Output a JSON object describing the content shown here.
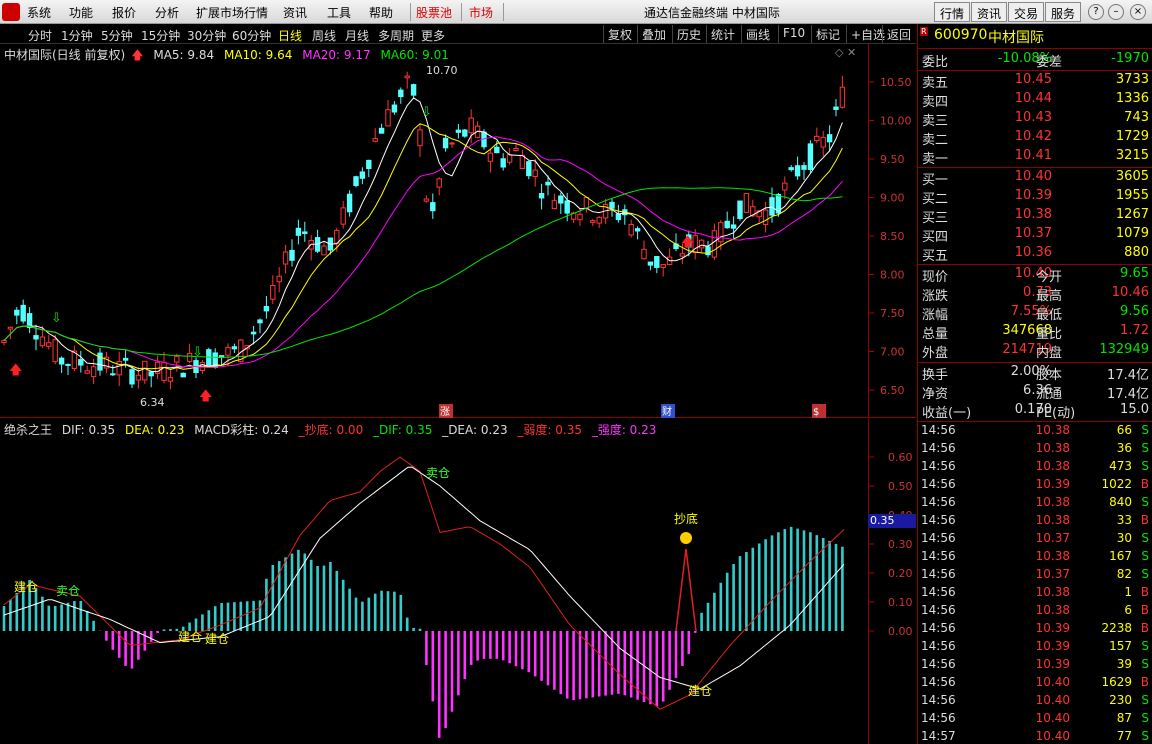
{
  "menu": {
    "items": [
      "系统",
      "功能",
      "报价",
      "分析",
      "扩展市场行情",
      "资讯",
      "工具",
      "帮助"
    ],
    "pool": "股票池",
    "market": "市场",
    "window_title": "通达信金融终端  中材国际",
    "right_buttons": [
      "行情",
      "资讯",
      "交易",
      "服务"
    ]
  },
  "toolbar": {
    "periods": [
      "分时",
      "1分钟",
      "5分钟",
      "15分钟",
      "30分钟",
      "60分钟",
      "日线",
      "周线",
      "月线",
      "多周期",
      "更多"
    ],
    "active": "日线",
    "right": [
      "复权",
      "叠加",
      "历史",
      "统计",
      "画线",
      "F10",
      "标记",
      "+自选",
      "返回"
    ]
  },
  "kinfo": {
    "title": "中材国际(日线 前复权)",
    "ma5": "MA5: 9.84",
    "ma10": "MA10: 9.64",
    "ma20": "MA20: 9.17",
    "ma60": "MA60: 9.01",
    "high_label": "10.70",
    "low_label": "6.34",
    "yticks": [
      "10.50",
      "10.00",
      "9.50",
      "9.00",
      "8.50",
      "8.00",
      "7.50",
      "7.00",
      "6.50"
    ],
    "markers": [
      "涨",
      "财",
      "$"
    ],
    "colors": {
      "ma5": "#ffffff",
      "ma10": "#ffff00",
      "ma20": "#ff00ff",
      "ma60": "#00e600",
      "up": "#ff3333",
      "down": "#54ffff"
    }
  },
  "macd": {
    "title": "绝杀之王",
    "dif": "DIF: 0.35",
    "dea": "DEA: 0.23",
    "bar": "MACD彩柱: 0.24",
    "x_chaodi": "_抄底: 0.00",
    "x_dif": "_DIF: 0.35",
    "x_dea": "_DEA: 0.23",
    "x_ruodu": "_弱度: 0.35",
    "x_qiangdu": "_强度: 0.23",
    "yticks": [
      "0.60",
      "0.50",
      "0.40",
      "0.30",
      "0.20",
      "0.10",
      "0.00"
    ],
    "cur_value": "0.35",
    "signals": {
      "build": "建仓",
      "sell": "卖仓",
      "bottom": "抄底"
    }
  },
  "quote": {
    "code": "600970",
    "name": "中材国际",
    "weibi_label": "委比",
    "weibi": "-10.08%",
    "weicha_label": "委差",
    "weicha": "-1970",
    "asks": [
      {
        "label": "卖五",
        "price": "10.45",
        "vol": "3733"
      },
      {
        "label": "卖四",
        "price": "10.44",
        "vol": "1336"
      },
      {
        "label": "卖三",
        "price": "10.43",
        "vol": "743"
      },
      {
        "label": "卖二",
        "price": "10.42",
        "vol": "1729"
      },
      {
        "label": "卖一",
        "price": "10.41",
        "vol": "3215"
      }
    ],
    "bids": [
      {
        "label": "买一",
        "price": "10.40",
        "vol": "3605"
      },
      {
        "label": "买二",
        "price": "10.39",
        "vol": "1955"
      },
      {
        "label": "买三",
        "price": "10.38",
        "vol": "1267"
      },
      {
        "label": "买四",
        "price": "10.37",
        "vol": "1079"
      },
      {
        "label": "买五",
        "price": "10.36",
        "vol": "880"
      }
    ],
    "stats": [
      {
        "l1": "现价",
        "v1": "10.40",
        "c1": "red",
        "l2": "今开",
        "v2": "9.65",
        "c2": "grn"
      },
      {
        "l1": "涨跌",
        "v1": "0.73",
        "c1": "red",
        "l2": "最高",
        "v2": "10.46",
        "c2": "red"
      },
      {
        "l1": "涨幅",
        "v1": "7.55%",
        "c1": "red",
        "l2": "最低",
        "v2": "9.56",
        "c2": "grn"
      },
      {
        "l1": "总量",
        "v1": "347668",
        "c1": "yel",
        "l2": "量比",
        "v2": "1.72",
        "c2": "red"
      },
      {
        "l1": "外盘",
        "v1": "214719",
        "c1": "red",
        "l2": "内盘",
        "v2": "132949",
        "c2": "grn"
      }
    ],
    "stats2": [
      {
        "l1": "换手",
        "v1": "2.00%",
        "l2": "股本",
        "v2": "17.4亿"
      },
      {
        "l1": "净资",
        "v1": "6.36",
        "l2": "流通",
        "v2": "17.4亿"
      },
      {
        "l1": "收益(一)",
        "v1": "0.170",
        "l2": "PE(动)",
        "v2": "15.0"
      }
    ],
    "ticks": [
      {
        "t": "14:56",
        "p": "10.38",
        "v": "66",
        "f": "S",
        "fc": "grn",
        "vc": "yel"
      },
      {
        "t": "14:56",
        "p": "10.38",
        "v": "36",
        "f": "S",
        "fc": "grn",
        "vc": "yel"
      },
      {
        "t": "14:56",
        "p": "10.38",
        "v": "473",
        "f": "S",
        "fc": "grn",
        "vc": "yel"
      },
      {
        "t": "14:56",
        "p": "10.39",
        "v": "1022",
        "f": "B",
        "fc": "red",
        "vc": "mag"
      },
      {
        "t": "14:56",
        "p": "10.38",
        "v": "840",
        "f": "S",
        "fc": "grn",
        "vc": "mag"
      },
      {
        "t": "14:56",
        "p": "10.38",
        "v": "33",
        "f": "B",
        "fc": "red",
        "vc": "yel"
      },
      {
        "t": "14:56",
        "p": "10.37",
        "v": "30",
        "f": "S",
        "fc": "grn",
        "vc": "yel"
      },
      {
        "t": "14:56",
        "p": "10.38",
        "v": "167",
        "f": "S",
        "fc": "grn",
        "vc": "yel"
      },
      {
        "t": "14:56",
        "p": "10.37",
        "v": "82",
        "f": "S",
        "fc": "grn",
        "vc": "yel"
      },
      {
        "t": "14:56",
        "p": "10.38",
        "v": "1",
        "f": "B",
        "fc": "red",
        "vc": "yel"
      },
      {
        "t": "14:56",
        "p": "10.38",
        "v": "6",
        "f": "B",
        "fc": "red",
        "vc": "yel"
      },
      {
        "t": "14:56",
        "p": "10.39",
        "v": "2238",
        "f": "B",
        "fc": "red",
        "vc": "mag"
      },
      {
        "t": "14:56",
        "p": "10.39",
        "v": "157",
        "f": "S",
        "fc": "grn",
        "vc": "yel"
      },
      {
        "t": "14:56",
        "p": "10.39",
        "v": "39",
        "f": "S",
        "fc": "grn",
        "vc": "yel"
      },
      {
        "t": "14:56",
        "p": "10.40",
        "v": "1629",
        "f": "B",
        "fc": "red",
        "vc": "mag"
      },
      {
        "t": "14:56",
        "p": "10.40",
        "v": "230",
        "f": "S",
        "fc": "grn",
        "vc": "yel"
      },
      {
        "t": "14:56",
        "p": "10.40",
        "v": "87",
        "f": "S",
        "fc": "grn",
        "vc": "yel"
      },
      {
        "t": "14:57",
        "p": "10.40",
        "v": "77",
        "f": "S",
        "fc": "grn",
        "vc": "yel"
      }
    ]
  }
}
